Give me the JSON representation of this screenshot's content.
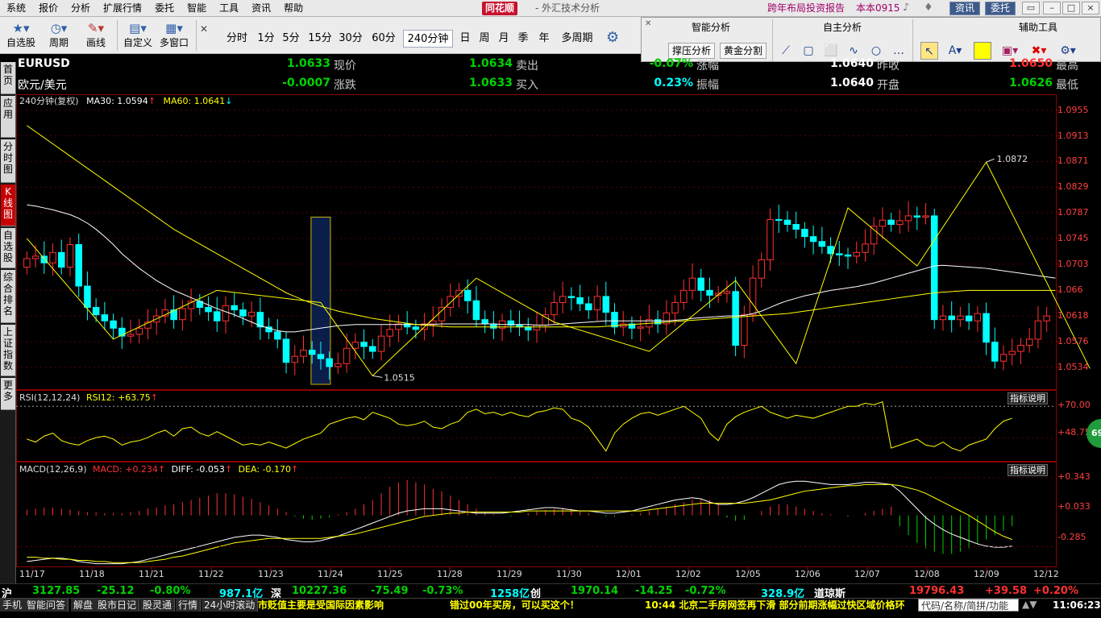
{
  "menu": {
    "items": [
      "系统",
      "报价",
      "分析",
      "扩展行情",
      "委托",
      "智能",
      "工具",
      "资讯",
      "帮助"
    ],
    "brand": "同花顺",
    "app_title": "- 外汇技术分析",
    "promo": "跨年布局投资报告",
    "version": "本本0915",
    "news_btn": "资讯",
    "trade_btn": "委托"
  },
  "toolbar": {
    "buttons": [
      "自选股",
      "周期",
      "画线",
      "自定义",
      "多窗口"
    ],
    "periods": [
      "分时",
      "1分",
      "5分",
      "15分",
      "30分",
      "60分",
      "240分钟",
      "日",
      "周",
      "月",
      "季",
      "年",
      "多周期"
    ],
    "active_period": "240分钟"
  },
  "floatbar": {
    "smart_title": "智能分析",
    "self_title": "自主分析",
    "aux_title": "辅助工具",
    "btn_pressure": "撑压分析",
    "btn_golden": "黄金分割"
  },
  "sidebar": {
    "tabs": [
      "首页",
      "应用",
      "分时图",
      "K线图",
      "自选股",
      "综合排名",
      "上证指数",
      "更多"
    ]
  },
  "quote": {
    "symbol": "EURUSD",
    "name": "欧元/美元",
    "row1": [
      {
        "label": "现价",
        "value": "1.0633",
        "color": "green"
      },
      {
        "label": "卖出",
        "value": "1.0634",
        "color": "green"
      },
      {
        "label": "涨幅",
        "value": "-0.07%",
        "color": "green"
      },
      {
        "label": "昨收",
        "value": "1.0640",
        "color": "white"
      },
      {
        "label": "最高",
        "value": "1.0650",
        "color": "red"
      }
    ],
    "row2": [
      {
        "label": "涨跌",
        "value": "-0.0007",
        "color": "green"
      },
      {
        "label": "买入",
        "value": "1.0633",
        "color": "green"
      },
      {
        "label": "振幅",
        "value": "0.23%",
        "color": "cyan"
      },
      {
        "label": "开盘",
        "value": "1.0640",
        "color": "white"
      },
      {
        "label": "最低",
        "value": "1.0626",
        "color": "green"
      }
    ]
  },
  "main_panel": {
    "period_label": "240分钟(复权)",
    "ma30_label": "MA30: 1.0594",
    "ma60_label": "MA60: 1.0641",
    "high_mark": "1.0872",
    "low_mark": "1.0515"
  },
  "rsi_panel": {
    "name": "RSI(12,12,24)",
    "value_label": "RSI12: +63.75",
    "help": "指标说明",
    "upper": "+70.00",
    "mid": "+48.75",
    "badge": "69"
  },
  "macd_panel": {
    "name": "MACD(12,26,9)",
    "macd": "MACD: +0.234",
    "diff": "DIFF: -0.053",
    "dea": "DEA: -0.170",
    "help": "指标说明",
    "ticks": [
      "+0.343",
      "+0.033",
      "-0.285"
    ]
  },
  "chart_data": {
    "type": "candlestick",
    "y_ticks": [
      1.0955,
      1.0913,
      1.0871,
      1.0829,
      1.0787,
      1.0745,
      1.0703,
      1.066,
      1.0618,
      1.0576,
      1.0534
    ],
    "ylim": [
      1.0506,
      1.0968
    ],
    "dates": [
      "11/17",
      "11/18",
      "11/21",
      "11/22",
      "11/23",
      "11/24",
      "11/25",
      "11/28",
      "11/29",
      "11/30",
      "12/01",
      "12/02",
      "12/05",
      "12/06",
      "12/07",
      "12/08",
      "12/09",
      "12/12"
    ],
    "closes": [
      1.0712,
      1.0716,
      1.0705,
      1.0722,
      1.0698,
      1.0735,
      1.0667,
      1.0632,
      1.062,
      1.061,
      1.0598,
      1.0585,
      1.0588,
      1.0598,
      1.0608,
      1.0618,
      1.0628,
      1.0612,
      1.063,
      1.0642,
      1.0632,
      1.0625,
      1.061,
      1.0635,
      1.0628,
      1.0618,
      1.0624,
      1.06,
      1.0592,
      1.058,
      1.0542,
      1.0552,
      1.0562,
      1.0555,
      1.0548,
      1.0535,
      1.054,
      1.0565,
      1.0575,
      1.0568,
      1.056,
      1.0585,
      1.0596,
      1.0605,
      1.06,
      1.0596,
      1.0605,
      1.061,
      1.0632,
      1.065,
      1.066,
      1.0643,
      1.0612,
      1.0605,
      1.0598,
      1.061,
      1.0603,
      1.06,
      1.0595,
      1.0603,
      1.062,
      1.064,
      1.065,
      1.0648,
      1.0638,
      1.0628,
      1.065,
      1.0624,
      1.06,
      1.0605,
      1.0598,
      1.06,
      1.0612,
      1.0605,
      1.0623,
      1.064,
      1.066,
      1.068,
      1.066,
      1.0652,
      1.0655,
      1.0658,
      1.057,
      1.062,
      1.068,
      1.071,
      1.0776,
      1.0775,
      1.0768,
      1.076,
      1.0748,
      1.074,
      1.0732,
      1.072,
      1.0718,
      1.0716,
      1.0722,
      1.0736,
      1.0765,
      1.0775,
      1.0768,
      1.0774,
      1.0782,
      1.078,
      1.0782,
      1.0612,
      1.0618,
      1.0612,
      1.0618,
      1.061,
      1.0622,
      1.0575,
      1.0544,
      1.0555,
      1.056,
      1.057,
      1.058,
      1.061,
      1.0618
    ],
    "opens": [
      1.0698,
      1.0712,
      1.0716,
      1.0705,
      1.0722,
      1.0698,
      1.0735,
      1.0667,
      1.0632,
      1.062,
      1.061,
      1.0598,
      1.0585,
      1.0588,
      1.0598,
      1.0608,
      1.0618,
      1.0628,
      1.0612,
      1.063,
      1.0642,
      1.0632,
      1.0625,
      1.061,
      1.0635,
      1.0628,
      1.0618,
      1.0624,
      1.06,
      1.0592,
      1.058,
      1.0542,
      1.0552,
      1.0562,
      1.0555,
      1.0548,
      1.0535,
      1.054,
      1.0565,
      1.0575,
      1.0568,
      1.056,
      1.0585,
      1.0596,
      1.0605,
      1.06,
      1.0596,
      1.0605,
      1.061,
      1.0632,
      1.065,
      1.066,
      1.0643,
      1.0612,
      1.0605,
      1.0598,
      1.061,
      1.0603,
      1.06,
      1.0595,
      1.0603,
      1.062,
      1.064,
      1.065,
      1.0648,
      1.0638,
      1.0628,
      1.065,
      1.0624,
      1.06,
      1.0605,
      1.0598,
      1.06,
      1.0612,
      1.0605,
      1.0623,
      1.064,
      1.066,
      1.068,
      1.066,
      1.0652,
      1.0655,
      1.0658,
      1.057,
      1.062,
      1.068,
      1.071,
      1.0776,
      1.0775,
      1.0768,
      1.076,
      1.0748,
      1.074,
      1.0732,
      1.072,
      1.0718,
      1.0716,
      1.0722,
      1.0736,
      1.0765,
      1.0775,
      1.0768,
      1.0774,
      1.0782,
      1.078,
      1.0782,
      1.0612,
      1.0618,
      1.0612,
      1.0618,
      1.061,
      1.0622,
      1.0575,
      1.0544,
      1.0555,
      1.056,
      1.057,
      1.058,
      1.061
    ],
    "ma_white": [
      1.08,
      1.0798,
      1.0795,
      1.0792,
      1.0788,
      1.0784,
      1.0778,
      1.077,
      1.076,
      1.0748,
      1.0735,
      1.072,
      1.0708,
      1.0696,
      1.0686,
      1.0676,
      1.0668,
      1.066,
      1.0654,
      1.0648,
      1.0642,
      1.0636,
      1.063,
      1.0625,
      1.062,
      1.0614,
      1.0608,
      1.0602,
      1.0598,
      1.0594,
      1.0592,
      1.0592,
      1.0594,
      1.0596,
      1.0598,
      1.06,
      1.0602,
      1.0603,
      1.0604,
      1.0604,
      1.0604,
      1.0604,
      1.0604,
      1.0604,
      1.0604,
      1.0604,
      1.0604,
      1.0604,
      1.0605,
      1.0605,
      1.0605,
      1.0605,
      1.0605,
      1.0605,
      1.0605,
      1.0604,
      1.0604,
      1.0604,
      1.0604,
      1.0603,
      1.0603,
      1.0604,
      1.0605,
      1.0606,
      1.0607,
      1.0608,
      1.0609,
      1.061,
      1.061,
      1.061,
      1.061,
      1.061,
      1.061,
      1.061,
      1.061,
      1.0611,
      1.0612,
      1.0614,
      1.0615,
      1.0616,
      1.0617,
      1.0618,
      1.0618,
      1.0619,
      1.0622,
      1.0626,
      1.0632,
      1.0638,
      1.0643,
      1.0647,
      1.0651,
      1.0654,
      1.0657,
      1.066,
      1.0662,
      1.0664,
      1.0666,
      1.0669,
      1.0672,
      1.0676,
      1.068,
      1.0684,
      1.0688,
      1.0692,
      1.0696,
      1.07,
      1.0701,
      1.07,
      1.0699,
      1.0698,
      1.0697,
      1.0696,
      1.0694,
      1.0692,
      1.069,
      1.0688,
      1.0686,
      1.0684,
      1.0682,
      1.068
    ],
    "ma_yellow": [
      1.093,
      1.092,
      1.091,
      1.09,
      1.089,
      1.088,
      1.087,
      1.086,
      1.085,
      1.084,
      1.083,
      1.082,
      1.081,
      1.08,
      1.079,
      1.078,
      1.077,
      1.076,
      1.0752,
      1.0744,
      1.0736,
      1.0728,
      1.072,
      1.0712,
      1.0704,
      1.0696,
      1.0688,
      1.068,
      1.0672,
      1.0664,
      1.0656,
      1.065,
      1.0644,
      1.0639,
      1.0634,
      1.063,
      1.0626,
      1.0623,
      1.062,
      1.0617,
      1.0614,
      1.0612,
      1.061,
      1.0608,
      1.0606,
      1.0604,
      1.0603,
      1.0602,
      1.0601,
      1.06,
      1.06,
      1.06,
      1.06,
      1.06,
      1.06,
      1.06,
      1.06,
      1.06,
      1.06,
      1.06,
      1.06,
      1.06,
      1.06,
      1.06,
      1.06,
      1.06,
      1.06,
      1.0601,
      1.0602,
      1.0603,
      1.0604,
      1.0605,
      1.0606,
      1.0607,
      1.0608,
      1.0609,
      1.061,
      1.0611,
      1.0612,
      1.0613,
      1.0614,
      1.0615,
      1.0616,
      1.0617,
      1.0618,
      1.0619,
      1.062,
      1.0621,
      1.0622,
      1.0624,
      1.0626,
      1.0628,
      1.063,
      1.0632,
      1.0634,
      1.0636,
      1.0638,
      1.064,
      1.0642,
      1.0644,
      1.0646,
      1.0648,
      1.065,
      1.0652,
      1.0654,
      1.0656,
      1.0657,
      1.0658,
      1.0659,
      1.066,
      1.066,
      1.066,
      1.066,
      1.066,
      1.066,
      1.066,
      1.066,
      1.066,
      1.066,
      1.066
    ],
    "zigzag": [
      [
        0,
        1.0745
      ],
      [
        10,
        1.058
      ],
      [
        22,
        1.066
      ],
      [
        34,
        1.064
      ],
      [
        40,
        1.052
      ],
      [
        52,
        1.068
      ],
      [
        61,
        1.0608
      ],
      [
        72,
        1.056
      ],
      [
        82,
        1.0676
      ],
      [
        89,
        1.054
      ],
      [
        95,
        1.0795
      ],
      [
        103,
        1.07
      ],
      [
        111,
        1.087
      ],
      [
        123,
        1.0532
      ]
    ],
    "rsi": [
      48,
      46,
      50,
      52,
      47,
      45,
      44,
      47,
      49,
      50,
      48,
      44,
      46,
      47,
      49,
      52,
      54,
      50,
      55,
      56,
      52,
      50,
      53,
      50,
      47,
      44,
      45,
      44,
      46,
      44,
      42,
      45,
      48,
      50,
      52,
      58,
      60,
      62,
      63,
      61,
      66,
      64,
      62,
      58,
      57,
      58,
      60,
      56,
      55,
      58,
      60,
      66,
      68,
      65,
      66,
      64,
      66,
      64,
      63,
      66,
      67,
      69,
      68,
      62,
      60,
      56,
      48,
      40,
      52,
      58,
      62,
      65,
      66,
      64,
      66,
      68,
      70,
      66,
      62,
      52,
      47,
      58,
      63,
      66,
      68,
      70,
      66,
      64,
      62,
      64,
      63,
      62,
      64,
      66,
      68,
      70,
      70,
      72,
      71,
      73,
      42,
      44,
      46,
      48,
      44,
      43,
      46,
      42,
      40,
      44,
      46,
      48,
      55,
      60,
      62
    ],
    "macd_hist": [
      0.05,
      0.06,
      0.07,
      0.07,
      0.06,
      0.05,
      0.04,
      0.03,
      0.03,
      0.02,
      0.02,
      0.02,
      0.03,
      0.04,
      0.06,
      0.07,
      0.09,
      0.1,
      0.12,
      0.14,
      0.16,
      0.18,
      0.2,
      0.2,
      0.19,
      0.17,
      0.15,
      0.12,
      0.09,
      0.06,
      0.03,
      -0.01,
      -0.03,
      -0.04,
      -0.03,
      -0.02,
      0.01,
      0.03,
      0.06,
      0.1,
      0.14,
      0.2,
      0.26,
      0.3,
      0.32,
      0.3,
      0.28,
      0.24,
      0.22,
      0.18,
      0.14,
      0.1,
      0.06,
      0.03,
      0.01,
      0.0,
      -0.01,
      0.0,
      0.02,
      0.04,
      0.05,
      0.06,
      0.07,
      0.06,
      0.04,
      0.02,
      0.0,
      -0.01,
      -0.01,
      0.0,
      0.01,
      0.02,
      0.04,
      0.06,
      0.08,
      0.1,
      0.12,
      0.14,
      0.15,
      0.14,
      0.1,
      -0.02,
      -0.05,
      -0.04,
      0.0,
      0.04,
      0.08,
      0.1,
      0.1,
      0.08,
      0.06,
      0.04,
      0.02,
      0.01,
      0.0,
      -0.01,
      0.0,
      0.02,
      0.04,
      0.06,
      0.08,
      -0.1,
      -0.18,
      -0.25,
      -0.3,
      -0.33,
      -0.35,
      -0.35,
      -0.33,
      -0.3,
      -0.26,
      -0.22,
      -0.18,
      -0.14,
      -0.1
    ],
    "macd_diff": [
      -0.42,
      -0.41,
      -0.4,
      -0.39,
      -0.39,
      -0.4,
      -0.42,
      -0.43,
      -0.44,
      -0.44,
      -0.44,
      -0.44,
      -0.43,
      -0.42,
      -0.4,
      -0.38,
      -0.36,
      -0.34,
      -0.32,
      -0.3,
      -0.28,
      -0.26,
      -0.24,
      -0.22,
      -0.2,
      -0.19,
      -0.18,
      -0.18,
      -0.19,
      -0.2,
      -0.22,
      -0.23,
      -0.24,
      -0.24,
      -0.23,
      -0.21,
      -0.19,
      -0.16,
      -0.13,
      -0.1,
      -0.07,
      -0.04,
      -0.01,
      0.02,
      0.04,
      0.05,
      0.06,
      0.06,
      0.06,
      0.05,
      0.04,
      0.03,
      0.02,
      0.02,
      0.02,
      0.02,
      0.03,
      0.04,
      0.05,
      0.06,
      0.07,
      0.07,
      0.06,
      0.05,
      0.04,
      0.04,
      0.03,
      0.02,
      0.02,
      0.03,
      0.04,
      0.06,
      0.08,
      0.1,
      0.12,
      0.14,
      0.15,
      0.16,
      0.15,
      0.12,
      0.1,
      0.1,
      0.11,
      0.13,
      0.16,
      0.2,
      0.24,
      0.28,
      0.3,
      0.31,
      0.31,
      0.3,
      0.29,
      0.28,
      0.28,
      0.28,
      0.29,
      0.3,
      0.3,
      0.29,
      0.28,
      0.22,
      0.14,
      0.06,
      -0.02,
      -0.08,
      -0.13,
      -0.17,
      -0.2,
      -0.23,
      -0.26,
      -0.28,
      -0.29,
      -0.29,
      -0.28
    ],
    "macd_dea": [
      -0.38,
      -0.38,
      -0.39,
      -0.39,
      -0.4,
      -0.4,
      -0.41,
      -0.41,
      -0.42,
      -0.42,
      -0.43,
      -0.43,
      -0.43,
      -0.43,
      -0.42,
      -0.41,
      -0.4,
      -0.38,
      -0.37,
      -0.35,
      -0.33,
      -0.31,
      -0.29,
      -0.27,
      -0.25,
      -0.24,
      -0.23,
      -0.22,
      -0.21,
      -0.21,
      -0.21,
      -0.21,
      -0.21,
      -0.21,
      -0.21,
      -0.2,
      -0.19,
      -0.18,
      -0.17,
      -0.15,
      -0.13,
      -0.11,
      -0.09,
      -0.07,
      -0.05,
      -0.03,
      -0.01,
      0.0,
      0.01,
      0.02,
      0.02,
      0.03,
      0.03,
      0.03,
      0.03,
      0.03,
      0.03,
      0.03,
      0.04,
      0.04,
      0.04,
      0.04,
      0.04,
      0.04,
      0.04,
      0.04,
      0.04,
      0.04,
      0.04,
      0.04,
      0.04,
      0.04,
      0.05,
      0.06,
      0.07,
      0.08,
      0.09,
      0.1,
      0.11,
      0.11,
      0.11,
      0.11,
      0.11,
      0.11,
      0.12,
      0.13,
      0.14,
      0.16,
      0.18,
      0.2,
      0.22,
      0.23,
      0.24,
      0.25,
      0.26,
      0.27,
      0.27,
      0.28,
      0.28,
      0.28,
      0.28,
      0.27,
      0.25,
      0.23,
      0.2,
      0.16,
      0.12,
      0.08,
      0.04,
      0.0,
      -0.05,
      -0.1,
      -0.15,
      -0.19,
      -0.22
    ]
  },
  "index_bar": [
    {
      "text": "沪",
      "color": "white"
    },
    {
      "text": "3127.85",
      "color": "green"
    },
    {
      "text": "-25.12",
      "color": "green"
    },
    {
      "text": "-0.80%",
      "color": "green"
    },
    {
      "text": "987.1亿",
      "color": "cyan"
    },
    {
      "text": "深",
      "color": "white"
    },
    {
      "text": "10227.36",
      "color": "green"
    },
    {
      "text": "-75.49",
      "color": "green"
    },
    {
      "text": "-0.73%",
      "color": "green"
    },
    {
      "text": "1258亿",
      "color": "cyan"
    },
    {
      "text": "创",
      "color": "white"
    },
    {
      "text": "1970.14",
      "color": "green"
    },
    {
      "text": "-14.25",
      "color": "green"
    },
    {
      "text": "-0.72%",
      "color": "green"
    },
    {
      "text": "328.9亿",
      "color": "cyan"
    },
    {
      "text": "道琼斯",
      "color": "white"
    },
    {
      "text": "19796.43",
      "color": "red"
    },
    {
      "text": "+39.58",
      "color": "red"
    },
    {
      "text": "+0.20%",
      "color": "red"
    }
  ],
  "status_bar": {
    "tabs": [
      "手机",
      "智能问答",
      "解盘",
      "股市日记",
      "股灵通",
      "行情",
      "24小时滚动"
    ],
    "news1": "市贬值主要是受国际因素影响",
    "news2": "错过00年买房，可以买这个！",
    "news3": "10:44 北京二手房网签再下滑 部分前期涨幅过快区域价格环",
    "search_placeholder": "代码/名称/简拼/功能",
    "clock": "11:06:23"
  },
  "colors": {
    "up": "#ff3030",
    "down": "#00ffff",
    "ma30": "#ffffff",
    "ma60": "#ffff00",
    "zigzag": "#ffff00"
  }
}
